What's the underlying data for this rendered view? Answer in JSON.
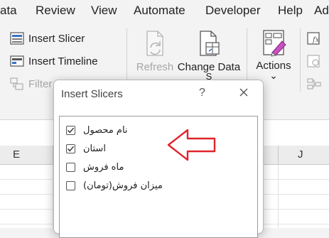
{
  "menubar": {
    "items": [
      "ata",
      "Review",
      "View",
      "Automate",
      "Developer",
      "Help",
      "Ad"
    ]
  },
  "ribbon": {
    "insert_slicer": "Insert Slicer",
    "insert_timeline": "Insert Timeline",
    "filter": "Filter",
    "refresh": "Refresh",
    "change_data": "Change Data",
    "change_data_sub": "S",
    "actions": "Actions",
    "actions_chevron": "⌄"
  },
  "sheet": {
    "column_headers": [
      "E",
      "J"
    ]
  },
  "dialog": {
    "title": "Insert Slicers",
    "help": "?",
    "fields": [
      {
        "label": "نام محصول",
        "checked": true
      },
      {
        "label": "استان",
        "checked": true
      },
      {
        "label": "ماه فروش",
        "checked": false
      },
      {
        "label": "میزان فروش(تومان)",
        "checked": false
      }
    ]
  },
  "annotation": {
    "arrow_color": "#e0242b"
  }
}
